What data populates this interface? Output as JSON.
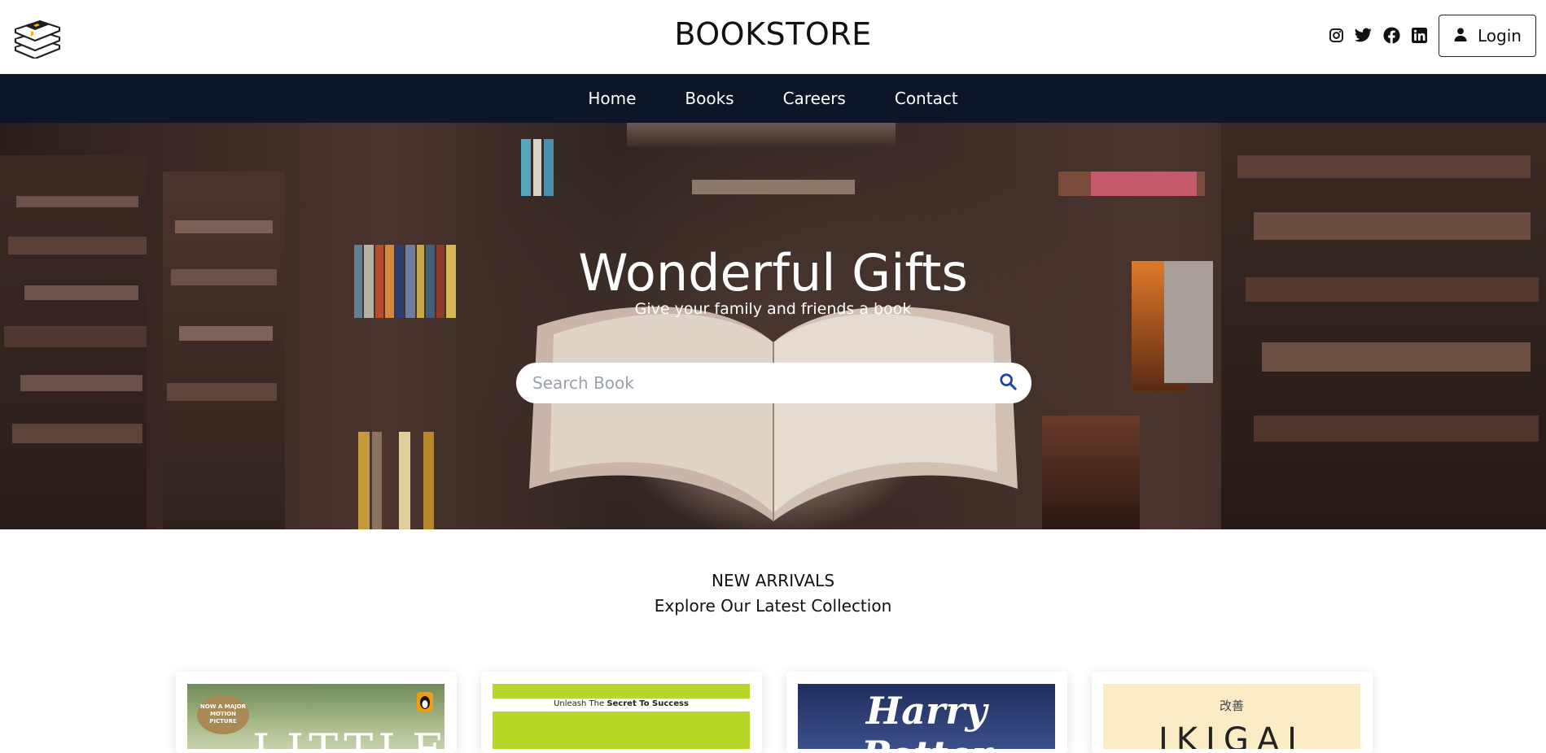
{
  "header": {
    "brand": "BOOKSTORE",
    "logo_icon": "books-stack-icon",
    "social_icons": [
      "instagram-icon",
      "twitter-icon",
      "facebook-icon",
      "linkedin-icon"
    ],
    "login_label": "Login",
    "login_icon": "user-icon"
  },
  "nav": {
    "items": [
      {
        "label": "Home"
      },
      {
        "label": "Books"
      },
      {
        "label": "Careers"
      },
      {
        "label": "Contact"
      }
    ],
    "background": "#0d1628"
  },
  "hero": {
    "title": "Wonderful Gifts",
    "subtitle": "Give your family and friends a book",
    "search_placeholder": "Search Book",
    "search_icon": "search-icon",
    "search_icon_color": "#1e3fb0"
  },
  "arrivals": {
    "heading": "NEW ARRIVALS",
    "subheading": "Explore Our Latest Collection",
    "books": [
      {
        "cover_badge": "NOW A MAJOR MOTION PICTURE",
        "cover_title": "LITTLE"
      },
      {
        "cover_tagline_prefix": "Unleash The ",
        "cover_tagline_bold": "Secret To Success"
      },
      {
        "cover_title": "Harry Potter"
      },
      {
        "cover_kanji": "改善",
        "cover_title": "IKIGAI"
      }
    ]
  }
}
